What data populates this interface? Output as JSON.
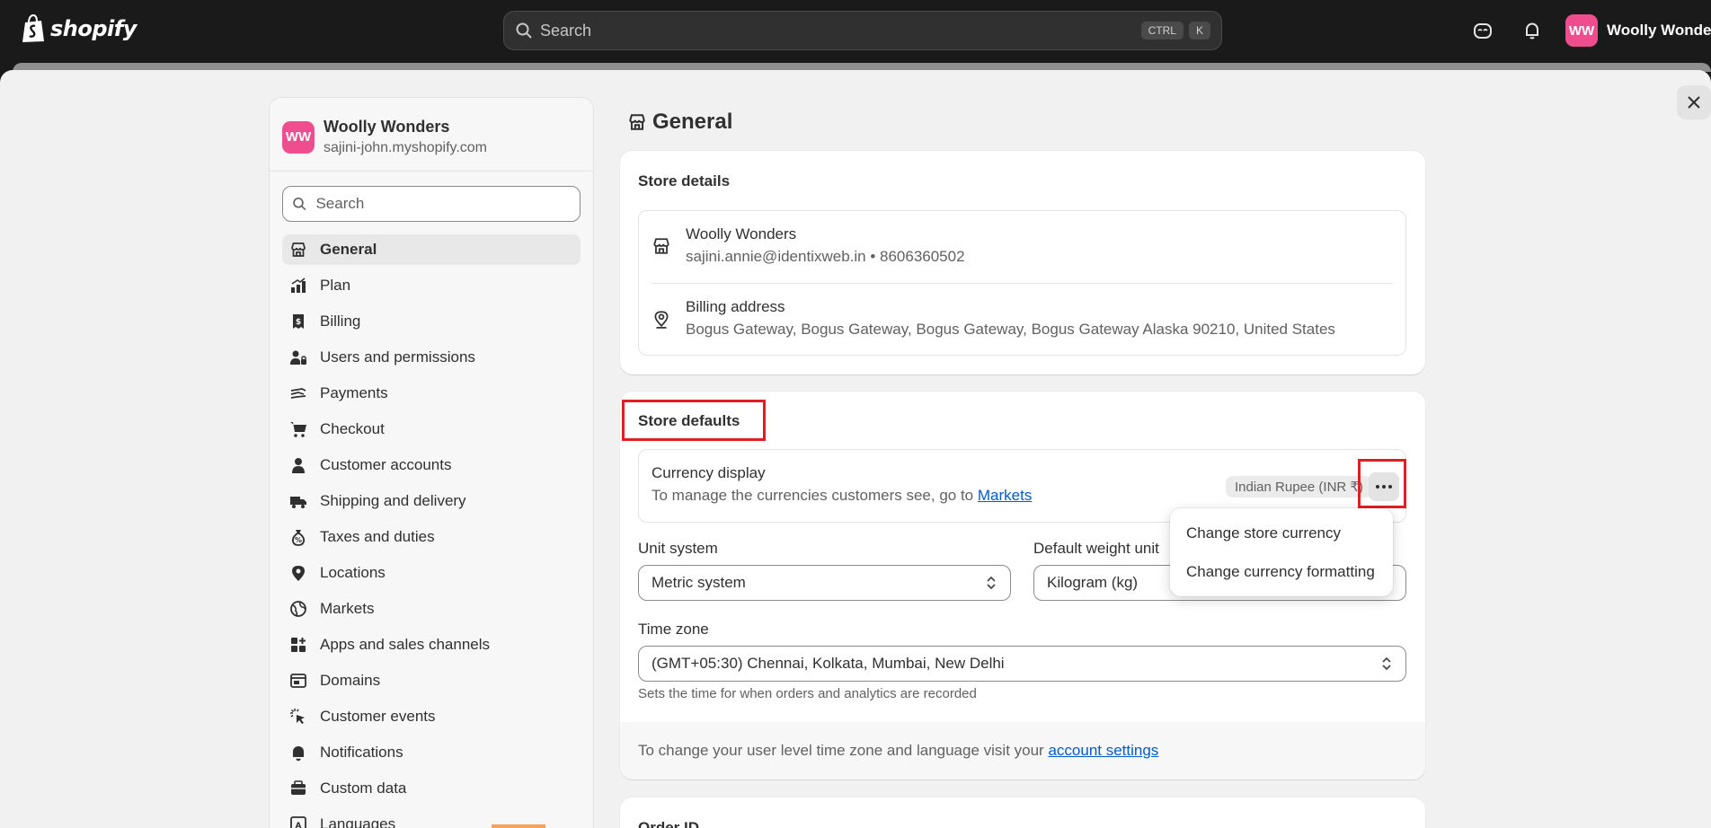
{
  "topbar": {
    "logo_text": "shopify",
    "search_placeholder": "Search",
    "shortcut_keys": [
      "CTRL",
      "K"
    ],
    "user": {
      "initials": "WW",
      "name": "Woolly Wonders"
    }
  },
  "sidebar": {
    "store": {
      "initials": "WW",
      "name": "Woolly Wonders",
      "domain": "sajini-john.myshopify.com"
    },
    "search_placeholder": "Search",
    "items": [
      {
        "label": "General",
        "icon": "store-icon",
        "active": true
      },
      {
        "label": "Plan",
        "icon": "plan-icon"
      },
      {
        "label": "Billing",
        "icon": "billing-icon"
      },
      {
        "label": "Users and permissions",
        "icon": "users-icon"
      },
      {
        "label": "Payments",
        "icon": "payments-icon"
      },
      {
        "label": "Checkout",
        "icon": "cart-icon"
      },
      {
        "label": "Customer accounts",
        "icon": "person-icon"
      },
      {
        "label": "Shipping and delivery",
        "icon": "truck-icon"
      },
      {
        "label": "Taxes and duties",
        "icon": "money-bag-icon"
      },
      {
        "label": "Locations",
        "icon": "location-icon"
      },
      {
        "label": "Markets",
        "icon": "globe-icon"
      },
      {
        "label": "Apps and sales channels",
        "icon": "apps-icon"
      },
      {
        "label": "Domains",
        "icon": "domains-icon"
      },
      {
        "label": "Customer events",
        "icon": "cursor-icon"
      },
      {
        "label": "Notifications",
        "icon": "bell-icon"
      },
      {
        "label": "Custom data",
        "icon": "database-icon"
      },
      {
        "label": "Languages",
        "icon": "language-icon"
      }
    ]
  },
  "page": {
    "title": "General"
  },
  "store_details": {
    "title": "Store details",
    "name": "Woolly Wonders",
    "contact": "sajini.annie@identixweb.in • 8606360502",
    "billing_label": "Billing address",
    "billing_address": "Bogus Gateway, Bogus Gateway, Bogus Gateway, Bogus Gateway Alaska 90210, United States"
  },
  "store_defaults": {
    "title": "Store defaults",
    "currency_title": "Currency display",
    "currency_desc": "To manage the currencies customers see, go to",
    "currency_link": "Markets",
    "currency_badge": "Indian Rupee (INR ₹)",
    "menu_items": [
      "Change store currency",
      "Change currency formatting"
    ],
    "unit_label": "Unit system",
    "unit_value": "Metric system",
    "weight_label": "Default weight unit",
    "weight_value": "Kilogram (kg)",
    "timezone_label": "Time zone",
    "timezone_value": "(GMT+05:30) Chennai, Kolkata, Mumbai, New Delhi",
    "timezone_help": "Sets the time for when orders and analytics are recorded",
    "footer_text": "To change your user level time zone and language visit your",
    "footer_link": "account settings"
  },
  "order_id": {
    "title": "Order ID"
  },
  "colors": {
    "accent_link": "#005bd3",
    "highlight": "#e01e26",
    "avatar": "#ef4d8e"
  }
}
